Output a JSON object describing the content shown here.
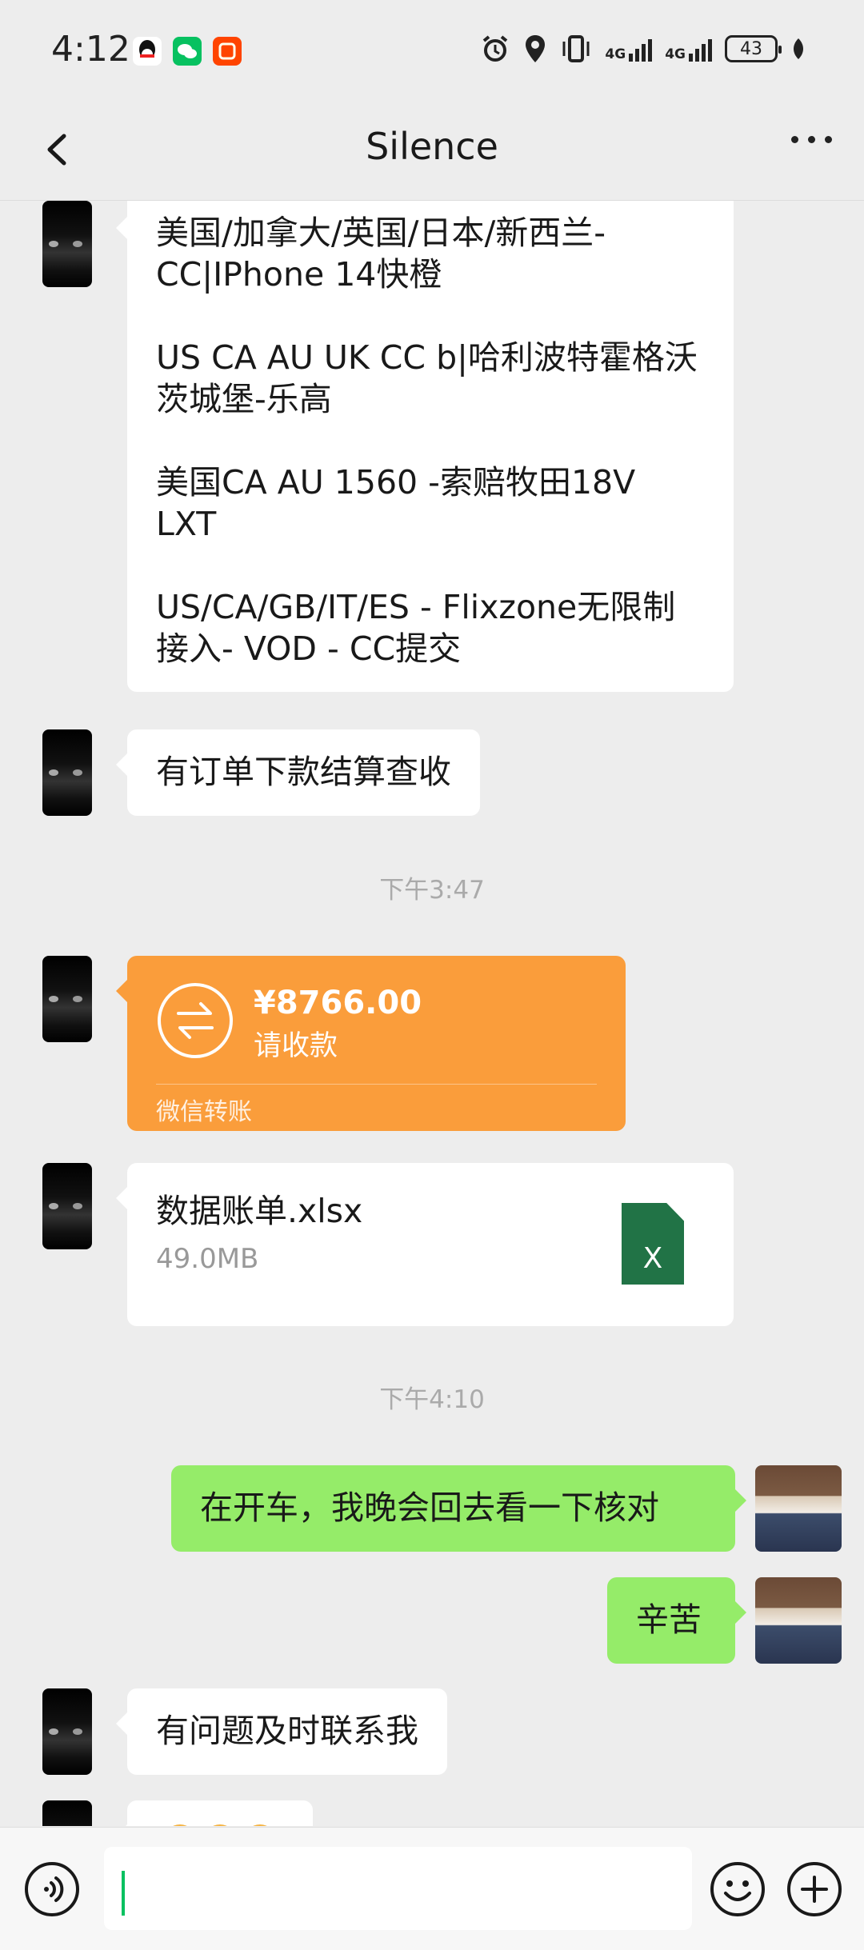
{
  "status_bar": {
    "time": "4:12",
    "network_1": "4G",
    "network_2": "4G",
    "battery": "43",
    "colors": {
      "qq": "#12b7f5",
      "wechat": "#07c160",
      "taobao": "#ff4400"
    }
  },
  "nav": {
    "title": "Silence"
  },
  "messages": {
    "long_text": [
      "美国/加拿大/英国/日本/新西兰-CC|IPhone 14快橙",
      "US CA AU UK CC b|哈利波特霍格沃茨城堡-乐高",
      "美国CA AU 1560 -索赔牧田18V LXT",
      "US/CA/GB/IT/ES - Flixzone无限制接入- VOD - CC提交"
    ],
    "order_text": "有订单下款结算查收",
    "time_1": "下午3:47",
    "transfer": {
      "amount": "¥8766.00",
      "status": "请收款",
      "footer": "微信转账"
    },
    "file": {
      "name": "数据账单.xlsx",
      "size": "49.0MB",
      "icon_letter": "X"
    },
    "time_2": "下午4:10",
    "reply_1": "在开车，我晚会回去看一下核对",
    "reply_2": "辛苦",
    "last_text": "有问题及时联系我"
  },
  "input_bar": {
    "value": ""
  },
  "theme": {
    "bubble_me": "#95ec69",
    "transfer": "#fa9d3b",
    "accent": "#07c160"
  }
}
